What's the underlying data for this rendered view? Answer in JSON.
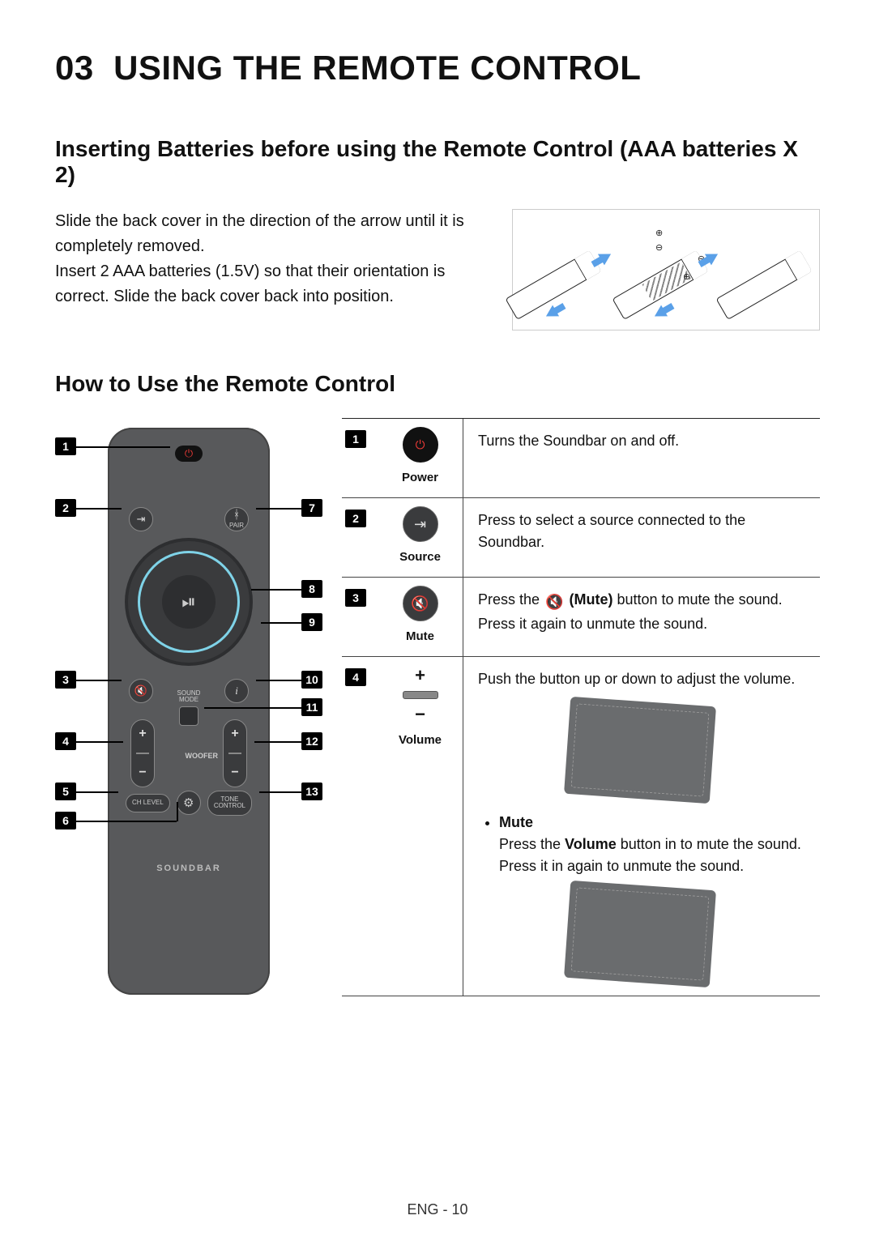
{
  "chapter": {
    "number": "03",
    "title": "USING THE REMOTE CONTROL"
  },
  "section_battery": {
    "heading": "Inserting Batteries before using the Remote Control (AAA batteries X 2)",
    "para1": "Slide the back cover in the direction of the arrow until it is completely removed.",
    "para2": "Insert 2 AAA batteries (1.5V) so that their orientation is correct. Slide the back cover back into position."
  },
  "section_howto": {
    "heading": "How to Use the Remote Control"
  },
  "remote": {
    "brand": "SOUNDBAR",
    "pair": "PAIR",
    "sound_mode": "SOUND\nMODE",
    "woofer": "WOOFER",
    "ch_level": "CH LEVEL",
    "tone_control": "TONE\nCONTROL",
    "play_glyph": "⏯",
    "callouts": [
      "1",
      "2",
      "3",
      "4",
      "5",
      "6",
      "7",
      "8",
      "9",
      "10",
      "11",
      "12",
      "13"
    ]
  },
  "functions": [
    {
      "num": "1",
      "label": "Power",
      "desc_plain": "Turns the Soundbar on and off."
    },
    {
      "num": "2",
      "label": "Source",
      "desc_plain": "Press to select a source connected to the Soundbar."
    },
    {
      "num": "3",
      "label": "Mute",
      "desc_pre": "Press the ",
      "desc_mid_bold": "(Mute)",
      "desc_post": " button to mute the sound. Press it again to unmute the sound."
    },
    {
      "num": "4",
      "label": "Volume",
      "desc_plain": "Push the button up or down to adjust the volume.",
      "bullet_title": "Mute",
      "bullet_pre": "Press the ",
      "bullet_bold": "Volume",
      "bullet_post": " button in to mute the sound. Press it in again to unmute the sound."
    }
  ],
  "footer": "ENG - 10"
}
